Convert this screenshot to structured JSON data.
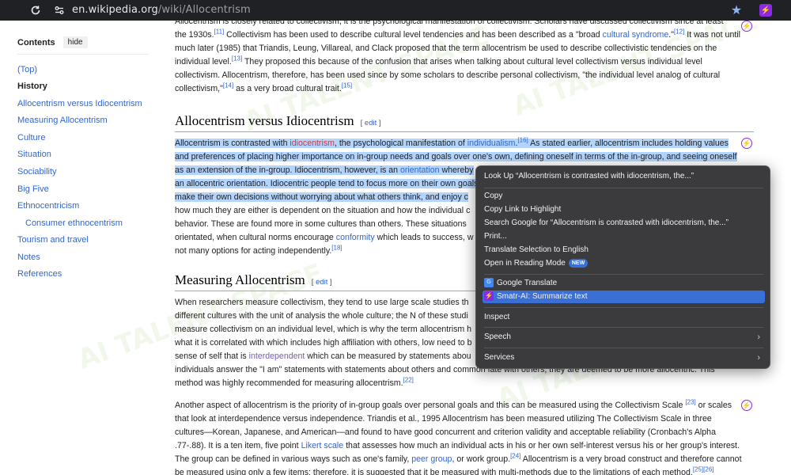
{
  "browser": {
    "url_host": "en.wikipedia.org",
    "url_path": "/wiki/Allocentrism",
    "reload_icon": "reload-icon",
    "site_info_icon": "site-settings-icon",
    "bookmark_icon": "star-icon",
    "extension_icon": "smatr-extension-icon"
  },
  "toc": {
    "title": "Contents",
    "hide_label": "hide",
    "items": [
      {
        "label": "(Top)"
      },
      {
        "label": "History"
      },
      {
        "label": "Allocentrism versus Idiocentrism"
      },
      {
        "label": "Measuring Allocentrism"
      },
      {
        "label": "Culture"
      },
      {
        "label": "Situation"
      },
      {
        "label": "Sociability"
      },
      {
        "label": "Big Five"
      },
      {
        "label": "Ethnocentricism"
      },
      {
        "label": "Consumer ethnocentrism"
      },
      {
        "label": "Tourism and travel"
      },
      {
        "label": "Notes"
      },
      {
        "label": "References"
      }
    ]
  },
  "article": {
    "p1": {
      "l0": "Allocentrism is closely related to collectivism, it is the psychological manifestation of collectivism. Scholars have discussed collectivism since at least",
      "l1a": "the 1930s.",
      "l1_ref": "[11]",
      "l1b": " Collectivism has been used to describe cultural level tendencies and has been described as a \"broad ",
      "l1_link": "cultural syndrome",
      "l1c": ".\"",
      "l1_ref2": "[12]",
      "l1d": " It was not until",
      "l2": "much later (1985) that Triandis, Leung, Villareal, and Clack proposed that the term allocentrism be used to describe collectivistic tendencies on the",
      "l3a": "individual level.",
      "l3_ref": "[13]",
      "l3b": " They proposed this because of the confusion that arises when talking about cultural level collectivism versus individual level",
      "l4": "collectivism. Allocentrism, therefore, has been used since by some scholars to describe personal collectivism, \"the individual level analog of cultural",
      "l5a": "collectivism,\"",
      "l5_ref": "[14]",
      "l5b": " as a very broad cultural trait.",
      "l5_ref2": "[15]"
    },
    "h_alloc": {
      "title": "Allocentrism versus Idiocentrism",
      "edit_open": "[ ",
      "edit": "edit",
      "edit_close": " ]"
    },
    "p2": {
      "l0a": "Allocentrism is contrasted with ",
      "l0_link": "idiocentrism",
      "l0b": ", the psychological manifestation of ",
      "l0_link2": "individualism",
      "l0c": ".",
      "l0_ref": "[16]",
      "l0d": " As stated earlier, allocentrism includes holding values",
      "l1": "and preferences of placing higher importance on in-group needs and goals over one's own, defining oneself in terms of the in-group, and seeing oneself",
      "l2a": "as an extension of the in-group. Idiocentrism, however, is an ",
      "l2_link": "orientation",
      "l2b": " whereby",
      "l3": "an allocentric orientation. Idiocentric people tend to focus more on their own goals",
      "l4": "make their own decisions without worrying about what others think, and enjoy c",
      "l5": "how much they are either is dependent on the situation and how the individual c",
      "l6": "behavior. These are found more in some cultures than others. These situations",
      "l7a": "orientated, when cultural norms encourage ",
      "l7_link": "conformity",
      "l7b": " which leads to success, w",
      "l8a": "not many options for acting independently.",
      "l8_ref": "[18]"
    },
    "h_measure": {
      "title": "Measuring Allocentrism",
      "edit_open": "[ ",
      "edit": "edit",
      "edit_close": " ]"
    },
    "p3": {
      "l0": "When researchers measure collectivism, they tend to use large scale studies th",
      "l1": "different cultures with the unit of analysis the whole culture; the N of these studi",
      "l2": "measure collectivism on an individual level, which is why the term allocentrism h",
      "l3": "what it is correlated with which includes high affiliation with others, low need to b",
      "l4a": "sense of self that is ",
      "l4_link": "interdependent",
      "l4b": " which can be measured by statements abou",
      "l5": "individuals answer the \"I am\" statements with statements about others and common fate with others, they are deemed to be more allocentric. This",
      "l6a": "method was highly recommended for measuring allocentrism.",
      "l6_ref": "[22]"
    },
    "p4": {
      "l0a": "Another aspect of allocentrism is the priority of in-group goals over personal goals and this can be measured using the Collectivism Scale ",
      "l0_ref": "[23]",
      "l0b": " or scales",
      "l1": "that look at interdependence versus independence. Triandis et al., 1995 Allocentrism has been measured utilizing The Collectivism Scale in three",
      "l2": "cultures—Korean, Japanese, and American—and found to have good concurrent and criterion validity and acceptable reliability (Cronbach's Alpha",
      "l3a": ".77-.88). It is a ten item, five point ",
      "l3_link": "Likert scale",
      "l3b": " that assesses how much an individual acts in his or her own self-interest versus his or her group's interest.",
      "l4a": "The group can be defined in various ways such as one's family, ",
      "l4_link": "peer group",
      "l4b": ", or work group.",
      "l4_ref": "[24]",
      "l4c": " Allocentrism is a very broad construct and therefore cannot",
      "l5a": "be measured using only a few items; therefore, it is suggested that it be measured with multi-methods due to the limitations of each method.",
      "l5_ref": "[25][26]"
    }
  },
  "context_menu": {
    "items": {
      "lookup": "Look Up “Allocentrism is contrasted with idiocentrism, the...”",
      "copy": "Copy",
      "copy_link": "Copy Link to Highlight",
      "search_google": "Search Google for “Allocentrism is contrasted with idiocentrism, the...”",
      "print": "Print...",
      "translate": "Translate Selection to English",
      "reading_mode": "Open in Reading Mode",
      "reading_badge": "NEW",
      "google_translate": "Google Translate",
      "smatr": "Smatr-AI: Summarize text",
      "inspect": "Inspect",
      "speech": "Speech",
      "services": "Services"
    }
  },
  "watermark": "AI TALENT SPACE",
  "colors": {
    "link": "#3366cc",
    "redlink": "#dd3333",
    "visited": "#795cb2",
    "selection": "#b3d4fc",
    "menu_bg": "#3b3b3d",
    "menu_highlight": "#3a6fd6",
    "browser_bar": "#202124"
  }
}
